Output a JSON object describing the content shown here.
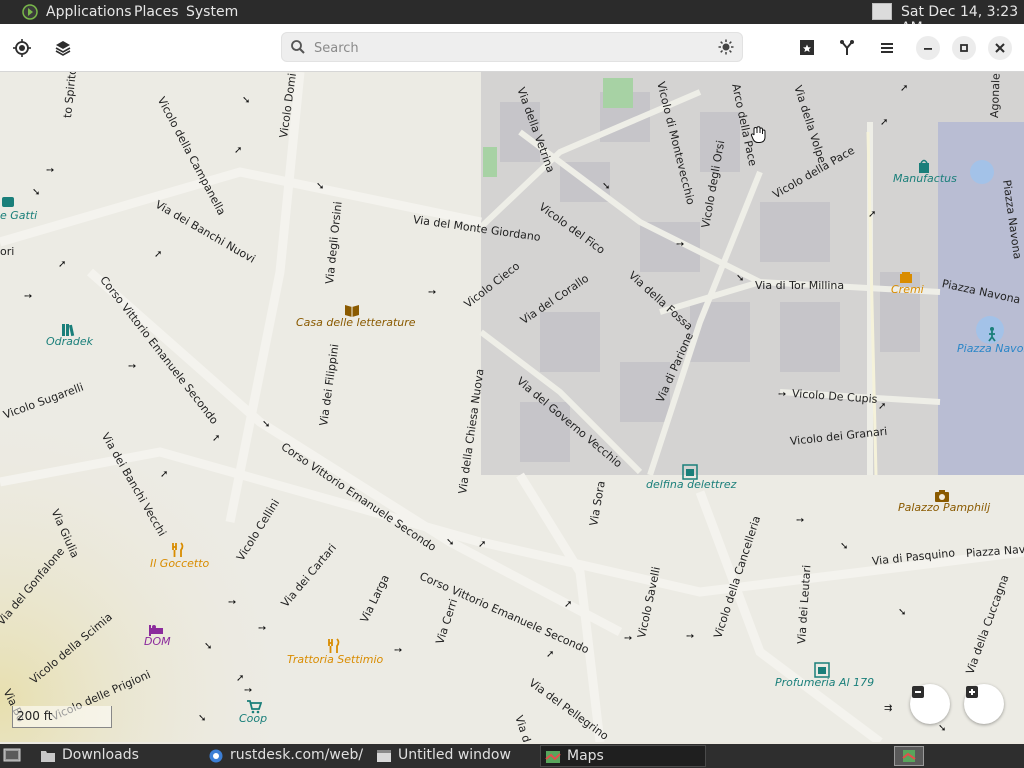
{
  "panel": {
    "menus": [
      "Applications",
      "Places",
      "System"
    ],
    "clock": "Sat Dec 14,  3:23 AM"
  },
  "header": {
    "search_placeholder": "Search",
    "icons": [
      "locate-icon",
      "layers-icon",
      "daynight-icon",
      "places-bookmarks-icon",
      "route-icon",
      "menu-icon",
      "minimize-icon",
      "maximize-icon",
      "close-icon"
    ]
  },
  "map": {
    "scale_label": "200 ft",
    "streets": [
      {
        "id": "s1",
        "text": "Via del Monte Giordano"
      },
      {
        "id": "s2",
        "text": "Vicolo del Fico"
      },
      {
        "id": "s3",
        "text": "Via dei Banchi Nuovi"
      },
      {
        "id": "s4",
        "text": "Via degli Orsini"
      },
      {
        "id": "s5",
        "text": "Vicolo della Campanella"
      },
      {
        "id": "s6",
        "text": "Vicolo Domi"
      },
      {
        "id": "s7",
        "text": "to Spirito"
      },
      {
        "id": "s8",
        "text": "Via della Vetrina"
      },
      {
        "id": "s9",
        "text": "Vicolo di Montevecchio"
      },
      {
        "id": "s10",
        "text": "Vicolo degli Orsi"
      },
      {
        "id": "s11",
        "text": "Arco della Pace"
      },
      {
        "id": "s12",
        "text": "Via della Volpe"
      },
      {
        "id": "s13",
        "text": "Vicolo della Pace"
      },
      {
        "id": "s14",
        "text": "Agonale"
      },
      {
        "id": "s15",
        "text": "Piazza Navona"
      },
      {
        "id": "s16",
        "text": "Via di Tor Millina"
      },
      {
        "id": "s17",
        "text": "Piazza Navona"
      },
      {
        "id": "s18",
        "text": "Corso Vittorio Emanuele Secondo"
      },
      {
        "id": "s19",
        "text": "Vicolo Cieco"
      },
      {
        "id": "s20",
        "text": "Via del Corallo"
      },
      {
        "id": "s21",
        "text": "Via della Fossa"
      },
      {
        "id": "s22",
        "text": "Via di Parione"
      },
      {
        "id": "s23",
        "text": "Vicolo Sugarelli"
      },
      {
        "id": "s24",
        "text": "Via dei Filippini"
      },
      {
        "id": "s25",
        "text": "Via della Chiesa Nuova"
      },
      {
        "id": "s26",
        "text": "Via del Governo Vecchio"
      },
      {
        "id": "s27",
        "text": "Vicolo De Cupis"
      },
      {
        "id": "s28",
        "text": "Vicolo dei Granari"
      },
      {
        "id": "s29",
        "text": "Via dei Banchi Vecchi"
      },
      {
        "id": "s30",
        "text": "Corso Vittorio Emanuele Secondo"
      },
      {
        "id": "s31",
        "text": "Via Sora"
      },
      {
        "id": "s32",
        "text": "Via Giulia"
      },
      {
        "id": "s33",
        "text": "Vicolo Cellini"
      },
      {
        "id": "s34",
        "text": "Via del Gonfalone"
      },
      {
        "id": "s35",
        "text": "Via dei Cartari"
      },
      {
        "id": "s36",
        "text": "Via Larga"
      },
      {
        "id": "s37",
        "text": "Corso Vittorio Emanuele Secondo"
      },
      {
        "id": "s38",
        "text": "Via Cerri"
      },
      {
        "id": "s39",
        "text": "Vicolo Savelli"
      },
      {
        "id": "s40",
        "text": "Vicolo della Cancelleria"
      },
      {
        "id": "s41",
        "text": "Via dei Leutari"
      },
      {
        "id": "s42",
        "text": "Via di Pasquino"
      },
      {
        "id": "s43",
        "text": "Piazza Nav"
      },
      {
        "id": "s44",
        "text": "Via della Cuccagna"
      },
      {
        "id": "s45",
        "text": "Vicolo della Scimia"
      },
      {
        "id": "s46",
        "text": "Vicolo delle Prigioni"
      },
      {
        "id": "s47",
        "text": "Via del Pellegrino"
      },
      {
        "id": "s48",
        "text": "Via Bo"
      },
      {
        "id": "s49",
        "text": "Via d"
      },
      {
        "id": "s50",
        "text": "ori"
      }
    ],
    "pois": [
      {
        "id": "p1",
        "text": "e Gatti",
        "color": "#1a7f7a"
      },
      {
        "id": "p2",
        "text": "Odradek",
        "color": "#1a7f7a"
      },
      {
        "id": "p3",
        "text": "Casa delle letterature",
        "color": "#8a5a00"
      },
      {
        "id": "p4",
        "text": "Manufactus",
        "color": "#1a7f7a"
      },
      {
        "id": "p5",
        "text": "Cremi",
        "color": "#d98c00"
      },
      {
        "id": "p6",
        "text": "Piazza Navona",
        "color": "#2a86c8"
      },
      {
        "id": "p7",
        "text": "delfina delettrez",
        "color": "#1a7f7a"
      },
      {
        "id": "p8",
        "text": "Palazzo Pamphilj",
        "color": "#8a5a00"
      },
      {
        "id": "p9",
        "text": "Il Goccetto",
        "color": "#d98c00"
      },
      {
        "id": "p10",
        "text": "DOM",
        "color": "#8b2a9c"
      },
      {
        "id": "p11",
        "text": "Trattoria Settimio",
        "color": "#d98c00"
      },
      {
        "id": "p12",
        "text": "Profumeria Al 179",
        "color": "#1a7f7a"
      },
      {
        "id": "p13",
        "text": "Coop",
        "color": "#1a7f7a"
      }
    ]
  },
  "taskbar": {
    "tasks": [
      {
        "label": "Downloads",
        "icon": "folder-icon"
      },
      {
        "label": "rustdesk.com/web/ ...",
        "icon": "browser-icon"
      },
      {
        "label": "Untitled window",
        "icon": "window-icon"
      },
      {
        "label": "Maps",
        "icon": "maps-icon"
      }
    ]
  }
}
